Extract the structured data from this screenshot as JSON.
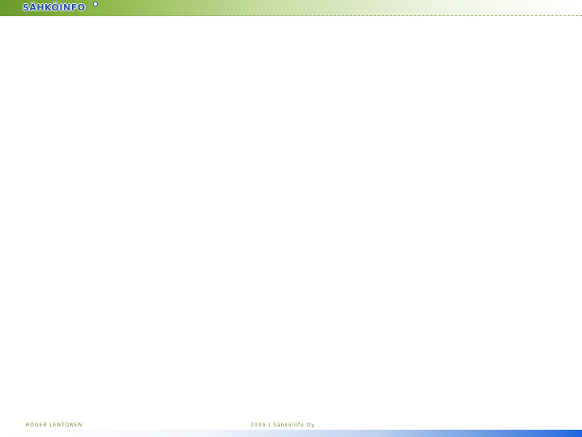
{
  "header": {
    "logo_text": "SÄHKÖINFO"
  },
  "footer": {
    "author": "ROGER LENTONEN",
    "copyright": "2009 | Sähköinfo Oy"
  },
  "colors": {
    "header_green": "#6a9a2a",
    "logo_blue": "#1f4fa8",
    "footer_text": "#6a8a2a",
    "footer_blue": "#1f66e0"
  }
}
